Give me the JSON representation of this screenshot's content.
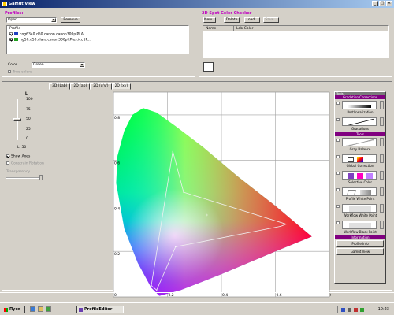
{
  "window": {
    "title": "Gamut View"
  },
  "profiles": {
    "title": "Profiles:",
    "open_value": "Open",
    "remove_label": "Remove",
    "list_header": "Profile",
    "items": [
      {
        "label": "cog6340.d50.canon.canon300plPLA...",
        "color": "#2040c0",
        "checked": true
      },
      {
        "label": "ng50.d50.clara.canon300pltPles.icc (P...",
        "color": "#20a020",
        "checked": true
      }
    ],
    "color_label": "Color",
    "color_value": "Green",
    "true_colors_label": "True colors"
  },
  "spot": {
    "title": "2D Spot Color Checker",
    "new_label": "New...",
    "delete_label": "Delete",
    "load_label": "Load...",
    "save_label": "Save...",
    "col_name": "Name",
    "col_lab": "Lab-Color"
  },
  "tabs": [
    {
      "label": "3D (Lab)",
      "active": false
    },
    {
      "label": "2D (ab)",
      "active": false
    },
    {
      "label": "2D (u'v')",
      "active": false
    },
    {
      "label": "2D (xy)",
      "active": true
    }
  ],
  "left_controls": {
    "l_label": "L",
    "ticks": [
      "100",
      "75",
      "50",
      "25",
      "0"
    ],
    "l_value": "L: 50",
    "show_axes_label": "Show Axes",
    "constrain_label": "Constrain Rotation",
    "transparency_label": "Transparency"
  },
  "chart_data": {
    "type": "scatter",
    "title": "",
    "xlabel": "x",
    "ylabel": "y",
    "xlim": [
      0,
      0.8
    ],
    "ylim": [
      0,
      0.9
    ],
    "x_ticks": [
      "0",
      "0.2",
      "0.4",
      "0.6",
      "0.8"
    ],
    "y_ticks": [
      "0",
      "0.2",
      "0.4",
      "0.6",
      "0.8"
    ],
    "grid": true,
    "series": [
      {
        "points": [
          [
            0.22,
            0.64
          ],
          [
            0.26,
            0.46
          ],
          [
            0.64,
            0.32
          ],
          [
            0.62,
            0.31
          ],
          [
            0.23,
            0.22
          ],
          [
            0.16,
            0.03
          ],
          [
            0.14,
            0.05
          ]
        ]
      }
    ]
  },
  "right_panel": {
    "head": "Tools",
    "gradation_header": "Gradation Corrections",
    "tools_header": "Tools",
    "info_header": "Information",
    "tools": [
      {
        "name": "Postlinearization"
      },
      {
        "name": "Gradations"
      },
      {
        "name": "Gray Balance"
      },
      {
        "name": "Global Correction"
      },
      {
        "name": "Selective Color"
      },
      {
        "name": "Profile White Point"
      },
      {
        "name": "Workflow White Point"
      },
      {
        "name": "Workflow Black Point"
      }
    ],
    "profile_info_label": "Profile Info",
    "gamut_view_label": "Gamut View"
  },
  "taskbar": {
    "start_label": "Пуск",
    "app_label": "ProfileEditor",
    "clock": "10:23"
  }
}
